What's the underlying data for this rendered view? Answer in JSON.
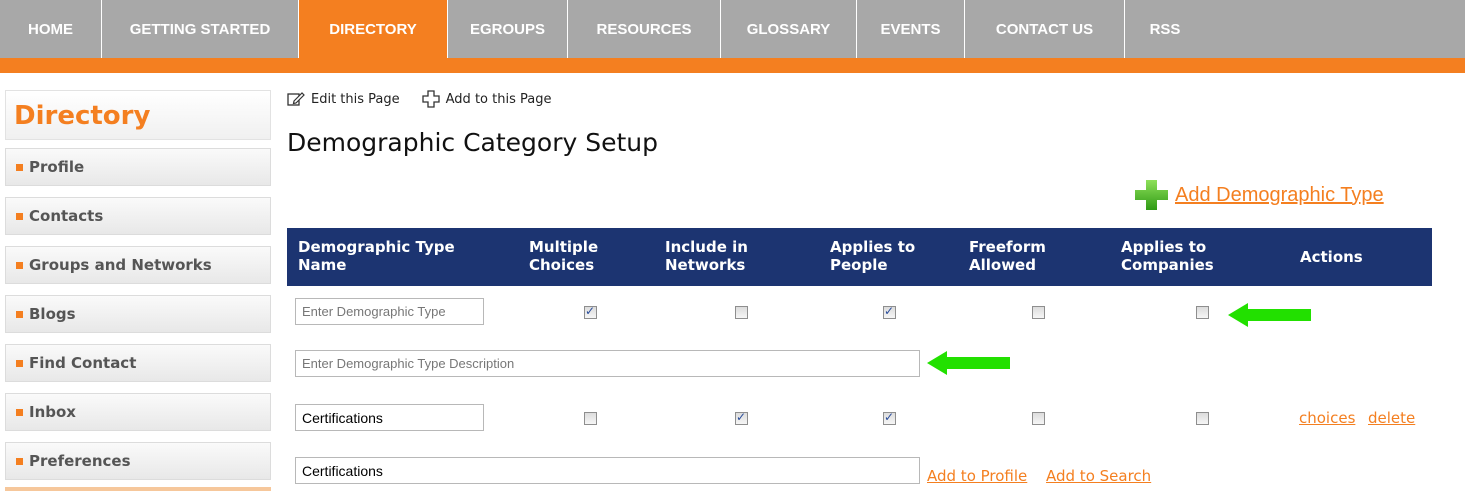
{
  "nav": {
    "items": [
      "HOME",
      "GETTING STARTED",
      "DIRECTORY",
      "EGROUPS",
      "RESOURCES",
      "GLOSSARY",
      "EVENTS",
      "CONTACT US",
      "RSS"
    ],
    "active": "DIRECTORY"
  },
  "sidebar": {
    "title": "Directory",
    "items": [
      "Profile",
      "Contacts",
      "Groups and Networks",
      "Blogs",
      "Find Contact",
      "Inbox",
      "Preferences"
    ]
  },
  "toolbar": {
    "edit_label": "Edit this Page",
    "add_label": "Add to this Page"
  },
  "page": {
    "title": "Demographic Category Setup",
    "add_type_label": "Add Demographic Type"
  },
  "table": {
    "headers": [
      [
        "Demographic Type",
        "Name"
      ],
      [
        "Multiple",
        "Choices"
      ],
      [
        "Include in",
        "Networks"
      ],
      [
        "Applies to",
        "People"
      ],
      [
        "Freeform",
        "Allowed"
      ],
      [
        "Applies to",
        "Companies"
      ],
      [
        "Actions"
      ]
    ],
    "new_row": {
      "name_placeholder": "Enter Demographic Type",
      "description_placeholder": "Enter Demographic Type Description",
      "checks": [
        true,
        false,
        true,
        false,
        false
      ]
    },
    "rows": [
      {
        "name": "Certifications",
        "description": "Certifications",
        "checks": [
          false,
          true,
          true,
          false,
          false
        ],
        "actions": [
          "choices",
          "delete"
        ],
        "links": [
          "Add to Profile",
          "Add to Search"
        ]
      }
    ]
  },
  "colors": {
    "brand_orange": "#f47f20",
    "header_blue": "#1c3471",
    "annotation_green": "#22e000"
  }
}
